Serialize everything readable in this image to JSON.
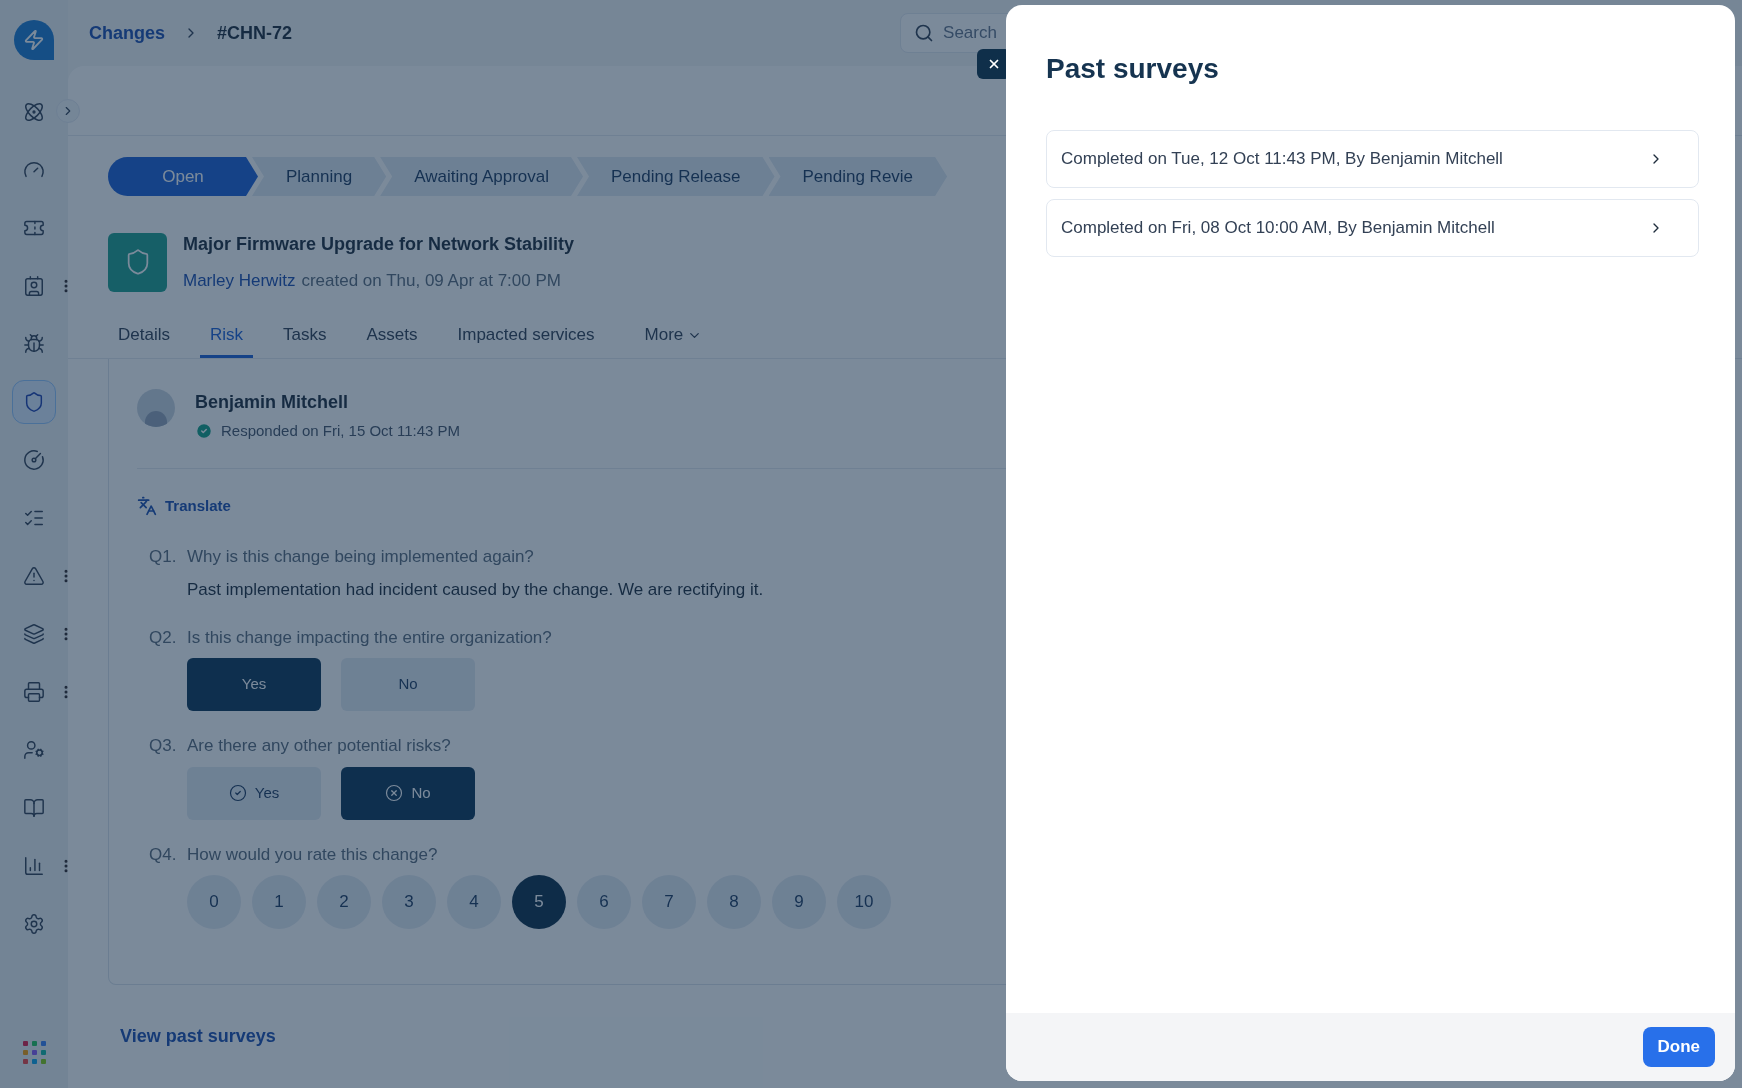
{
  "breadcrumb": [
    {
      "label": "Changes",
      "kind": "link"
    },
    {
      "label": "#CHN-72",
      "kind": "current"
    }
  ],
  "search": {
    "placeholder": "Search"
  },
  "sidebar": {
    "items": [
      {
        "selected": false,
        "menu": false
      },
      {
        "selected": false,
        "menu": false
      },
      {
        "selected": false,
        "menu": false
      },
      {
        "selected": false,
        "menu": true
      },
      {
        "selected": false,
        "menu": false
      },
      {
        "selected": true,
        "menu": false
      },
      {
        "selected": false,
        "menu": false
      },
      {
        "selected": false,
        "menu": false
      },
      {
        "selected": false,
        "menu": true
      },
      {
        "selected": false,
        "menu": true
      },
      {
        "selected": false,
        "menu": true
      },
      {
        "selected": false,
        "menu": false
      },
      {
        "selected": false,
        "menu": false
      },
      {
        "selected": false,
        "menu": true
      },
      {
        "selected": false,
        "menu": false
      }
    ]
  },
  "stages": [
    {
      "label": "Open",
      "selected": true
    },
    {
      "label": "Planning",
      "selected": false
    },
    {
      "label": "Awaiting Approval",
      "selected": false
    },
    {
      "label": "Pending Release",
      "selected": false
    },
    {
      "label": "Pending Revie",
      "selected": false
    }
  ],
  "change": {
    "title": "Major Firmware Upgrade for Network Stability",
    "author": "Marley Herwitz",
    "created": "created on Thu, 09 Apr at 7:00 PM"
  },
  "tabs": [
    {
      "label": "Details",
      "selected": false,
      "dropdown": false
    },
    {
      "label": "Risk",
      "selected": true,
      "dropdown": false
    },
    {
      "label": "Tasks",
      "selected": false,
      "dropdown": false
    },
    {
      "label": "Assets",
      "selected": false,
      "dropdown": false
    },
    {
      "label": "Impacted services",
      "selected": false,
      "dropdown": false
    },
    {
      "label": "More",
      "selected": false,
      "dropdown": true
    }
  ],
  "response": {
    "name": "Benjamin Mitchell",
    "responded": "Responded on Fri, 15 Oct 11:43 PM",
    "translate": "Translate"
  },
  "questions": [
    {
      "number": "Q1.",
      "text": "Why is this change being implemented again?",
      "kind": "text",
      "answer": "Past implementation had incident caused by the change. We are rectifying it."
    },
    {
      "number": "Q2.",
      "text": "Is this change impacting the entire organization?",
      "kind": "choice",
      "options": [
        {
          "label": "Yes",
          "selected": true
        },
        {
          "label": "No",
          "selected": false
        }
      ]
    },
    {
      "number": "Q3.",
      "text": "Are there any other potential risks?",
      "kind": "choice_icon",
      "options": [
        {
          "label": "Yes",
          "selected": false
        },
        {
          "label": "No",
          "selected": true
        }
      ]
    },
    {
      "number": "Q4.",
      "text": "How would you rate this change?",
      "kind": "rating",
      "options": [
        {
          "label": "0",
          "selected": false
        },
        {
          "label": "1",
          "selected": false
        },
        {
          "label": "2",
          "selected": false
        },
        {
          "label": "3",
          "selected": false
        },
        {
          "label": "4",
          "selected": false
        },
        {
          "label": "5",
          "selected": true
        },
        {
          "label": "6",
          "selected": false
        },
        {
          "label": "7",
          "selected": false
        },
        {
          "label": "8",
          "selected": false
        },
        {
          "label": "9",
          "selected": false
        },
        {
          "label": "10",
          "selected": false
        }
      ]
    }
  ],
  "view_past_surveys": "View past surveys",
  "drawer": {
    "title": "Past surveys",
    "surveys": [
      {
        "label": "Completed on Tue, 12 Oct 11:43 PM, By Benjamin Mitchell"
      },
      {
        "label": "Completed on Fri, 08 Oct 10:00 AM, By Benjamin Mitchell"
      }
    ],
    "done": "Done"
  }
}
